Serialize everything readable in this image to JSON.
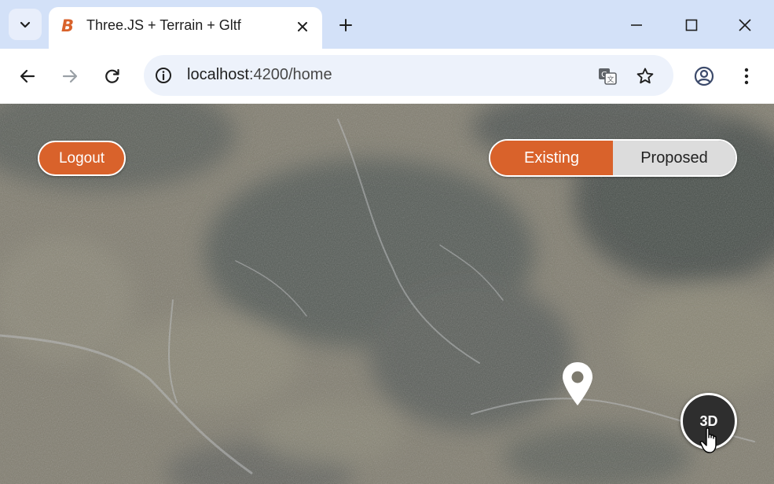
{
  "browser": {
    "tab": {
      "favicon": "B",
      "title": "Three.JS + Terrain + Gltf"
    },
    "url": {
      "host": "localhost",
      "rest": ":4200/home"
    }
  },
  "app": {
    "logout_label": "Logout",
    "view_toggle": {
      "options": [
        "Existing",
        "Proposed"
      ],
      "selected": "Existing"
    },
    "mode_button_label": "3D",
    "colors": {
      "accent": "#d9622b",
      "toggle_inactive": "#dcdcdc",
      "mode_button": "#2e2e2e"
    }
  },
  "icons": [
    "tab-search-icon",
    "close-icon",
    "plus-icon",
    "minimize-icon",
    "maximize-icon",
    "window-close-icon",
    "back-arrow-icon",
    "forward-arrow-icon",
    "reload-icon",
    "info-icon",
    "translate-icon",
    "star-icon",
    "profile-icon",
    "kebab-menu-icon",
    "map-pin-icon",
    "hand-cursor-icon"
  ]
}
